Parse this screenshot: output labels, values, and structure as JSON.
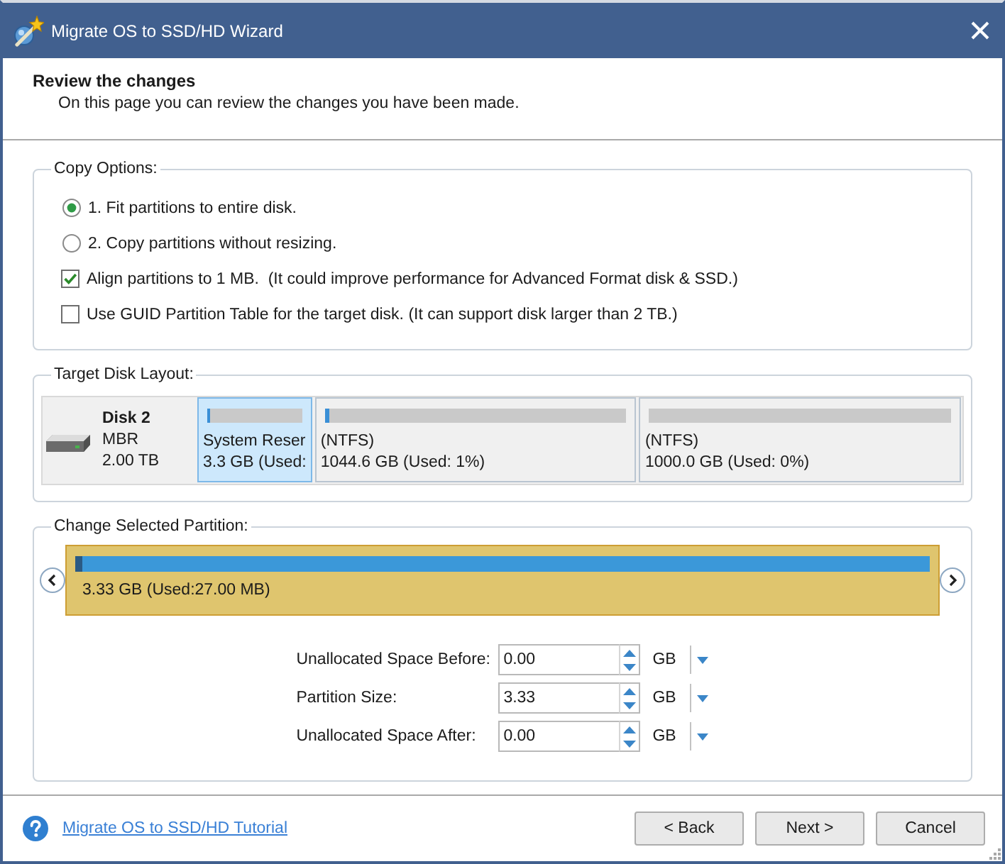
{
  "window": {
    "title": "Migrate OS to SSD/HD Wizard"
  },
  "header": {
    "title": "Review the changes",
    "subtitle": "On this page you can review the changes you have been made."
  },
  "copy_options": {
    "legend": "Copy Options:",
    "options": [
      {
        "kind": "radio",
        "label": "1. Fit partitions to entire disk.",
        "selected": true
      },
      {
        "kind": "radio",
        "label": "2. Copy partitions without resizing.",
        "selected": false
      },
      {
        "kind": "checkbox",
        "label": "Align partitions to 1 MB.  (It could improve performance for Advanced Format disk & SSD.)",
        "checked": true
      },
      {
        "kind": "checkbox",
        "label": "Use GUID Partition Table for the target disk. (It can support disk larger than 2 TB.)",
        "checked": false
      }
    ]
  },
  "target_disk_layout": {
    "legend": "Target Disk Layout:",
    "disk": {
      "name": "Disk 2",
      "type": "MBR",
      "size": "2.00 TB"
    },
    "partitions": [
      {
        "label": "System Reser",
        "size": "3.3 GB (Used:",
        "level": 0.03,
        "selected": true
      },
      {
        "label": "(NTFS)",
        "size": "1044.6 GB (Used: 1%)",
        "level": 0.013,
        "selected": false
      },
      {
        "label": "(NTFS)",
        "size": "1000.0 GB (Used: 0%)",
        "selected": false
      }
    ]
  },
  "change_selected_partition": {
    "legend": "Change Selected Partition:",
    "partition": {
      "size": "3.33 GB (Used:27.00 MB)",
      "level": 0.008
    },
    "fields": [
      {
        "label": "Unallocated Space Before:",
        "value": "0.00",
        "unit": "GB"
      },
      {
        "label": "Partition Size:",
        "value": "3.33",
        "unit": "GB"
      },
      {
        "label": "Unallocated Space After:",
        "value": "0.00",
        "unit": "GB"
      }
    ]
  },
  "footer": {
    "help_link": "Migrate OS to SSD/HD Tutorial",
    "buttons": [
      "< Back",
      "Next >",
      "Cancel"
    ]
  }
}
